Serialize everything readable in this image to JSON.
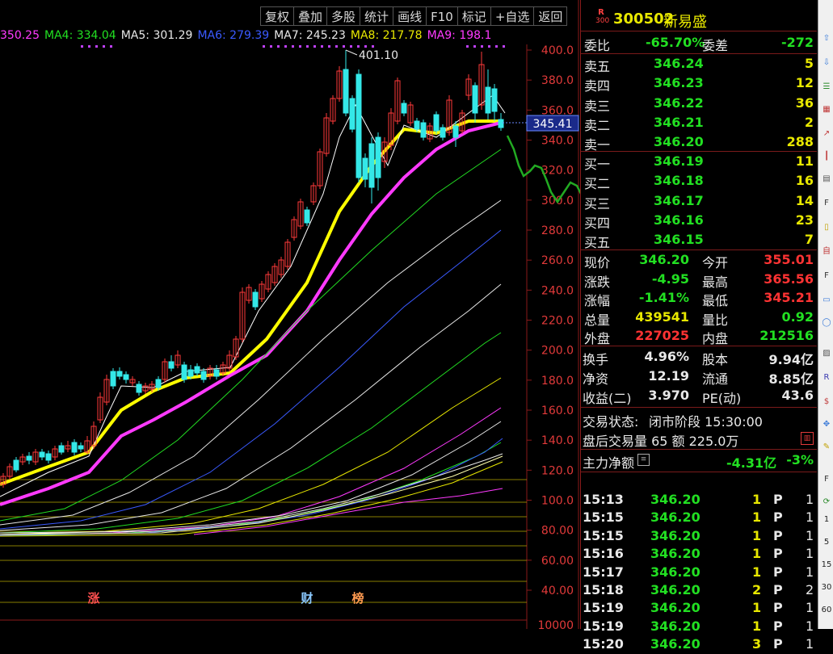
{
  "toolbar": {
    "items": [
      "复权",
      "叠加",
      "多股",
      "统计",
      "画线",
      "F10",
      "标记",
      "+自选",
      "返回"
    ]
  },
  "ma_row": [
    {
      "label": "350.25",
      "color": "#ff3aff"
    },
    {
      "label": "MA4: 334.04",
      "color": "#22e022"
    },
    {
      "label": "MA5: 301.29",
      "color": "#e8e8e8"
    },
    {
      "label": "MA6: 279.39",
      "color": "#3a5aff"
    },
    {
      "label": "MA7: 245.23",
      "color": "#e8e8e8"
    },
    {
      "label": "MA8: 217.78",
      "color": "#e8e800"
    },
    {
      "label": "MA9: 198.1",
      "color": "#ff3aff"
    }
  ],
  "chart": {
    "peak_label": "401.10",
    "current_price_tag": "345.41",
    "ylim": [
      40,
      400
    ],
    "y_ticks": [
      "400.0",
      "380.0",
      "360.0",
      "340.0",
      "320.0",
      "300.0",
      "280.0",
      "260.0",
      "240.0",
      "220.0",
      "200.0",
      "180.0",
      "160.0",
      "140.0",
      "120.0",
      "100.0",
      "80.00",
      "60.00",
      "40.00"
    ],
    "volume_tick": "10000",
    "markers": [
      "涨",
      "财",
      "榜"
    ]
  },
  "header": {
    "badge_top": "R",
    "badge_bottom": "300",
    "code": "300502",
    "name": "新易盛"
  },
  "ratio": {
    "label": "委比",
    "value": "-65.70%",
    "diff_label": "委差",
    "diff_value": "-272"
  },
  "sell_orders": [
    {
      "label": "卖五",
      "price": "346.24",
      "qty": "5"
    },
    {
      "label": "卖四",
      "price": "346.23",
      "qty": "12"
    },
    {
      "label": "卖三",
      "price": "346.22",
      "qty": "36"
    },
    {
      "label": "卖二",
      "price": "346.21",
      "qty": "2"
    },
    {
      "label": "卖一",
      "price": "346.20",
      "qty": "288"
    }
  ],
  "buy_orders": [
    {
      "label": "买一",
      "price": "346.19",
      "qty": "11"
    },
    {
      "label": "买二",
      "price": "346.18",
      "qty": "16"
    },
    {
      "label": "买三",
      "price": "346.17",
      "qty": "14"
    },
    {
      "label": "买四",
      "price": "346.16",
      "qty": "23"
    },
    {
      "label": "买五",
      "price": "346.15",
      "qty": "7"
    }
  ],
  "quote": [
    {
      "l1": "现价",
      "v1": "346.20",
      "c1": "#22e022",
      "l2": "今开",
      "v2": "355.01",
      "c2": "#ff3333"
    },
    {
      "l1": "涨跌",
      "v1": "-4.95",
      "c1": "#22e022",
      "l2": "最高",
      "v2": "365.56",
      "c2": "#ff3333"
    },
    {
      "l1": "涨幅",
      "v1": "-1.41%",
      "c1": "#22e022",
      "l2": "最低",
      "v2": "345.21",
      "c2": "#ff3333"
    },
    {
      "l1": "总量",
      "v1": "439541",
      "c1": "#e8e800",
      "l2": "量比",
      "v2": "0.92",
      "c2": "#22e022"
    },
    {
      "l1": "外盘",
      "v1": "227025",
      "c1": "#ff3333",
      "l2": "内盘",
      "v2": "212516",
      "c2": "#22e022"
    }
  ],
  "stats": [
    {
      "l1": "换手",
      "v1": "4.96%",
      "l2": "股本",
      "v2": "9.94亿"
    },
    {
      "l1": "净资",
      "v1": "12.19",
      "l2": "流通",
      "v2": "8.85亿"
    },
    {
      "l1": "收益(二)",
      "v1": "3.970",
      "l2": "PE(动)",
      "v2": "43.6"
    }
  ],
  "trade_status": {
    "label": "交易状态:",
    "value": "闭市阶段 15:30:00"
  },
  "after_hours": {
    "text": "盘后交易量 65 额 225.0万"
  },
  "net_flow": {
    "label": "主力净额",
    "value": "-4.31亿",
    "pct": "-3%"
  },
  "ticks": [
    {
      "time": "15:13",
      "price": "346.20",
      "qty": "1",
      "side": "P",
      "n": "1"
    },
    {
      "time": "15:15",
      "price": "346.20",
      "qty": "1",
      "side": "P",
      "n": "1"
    },
    {
      "time": "15:15",
      "price": "346.20",
      "qty": "1",
      "side": "P",
      "n": "1"
    },
    {
      "time": "15:16",
      "price": "346.20",
      "qty": "1",
      "side": "P",
      "n": "1"
    },
    {
      "time": "15:17",
      "price": "346.20",
      "qty": "1",
      "side": "P",
      "n": "1"
    },
    {
      "time": "15:18",
      "price": "346.20",
      "qty": "2",
      "side": "P",
      "n": "2"
    },
    {
      "time": "15:19",
      "price": "346.20",
      "qty": "1",
      "side": "P",
      "n": "1"
    },
    {
      "time": "15:19",
      "price": "346.20",
      "qty": "1",
      "side": "P",
      "n": "1"
    },
    {
      "time": "15:20",
      "price": "346.20",
      "qty": "3",
      "side": "P",
      "n": "1"
    }
  ],
  "sidebar_labels": [
    "1",
    "5",
    "15",
    "30",
    "60"
  ]
}
